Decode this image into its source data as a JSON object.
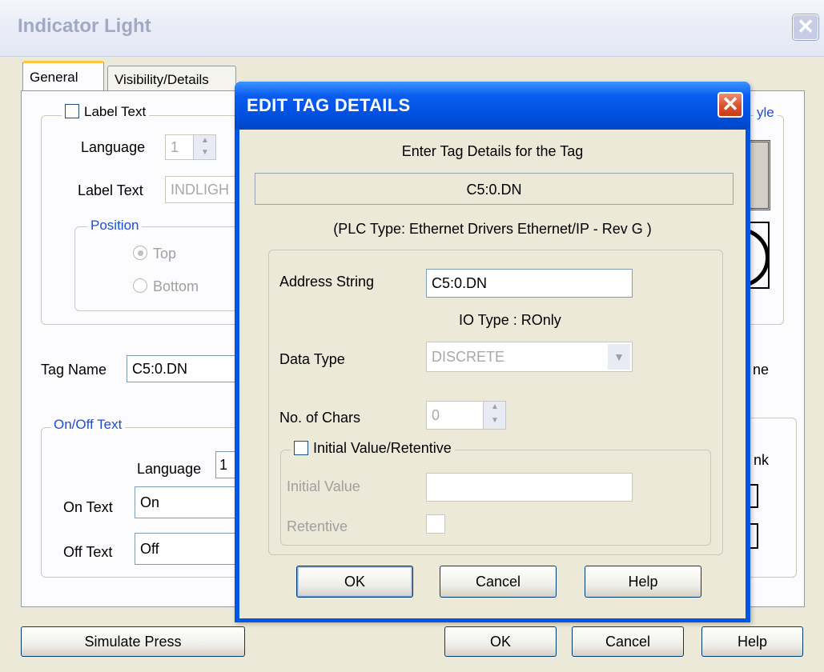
{
  "window": {
    "title": "Indicator Light",
    "close_glyph": "✕"
  },
  "tabs": [
    {
      "label": "General"
    },
    {
      "label": "Visibility/Details"
    }
  ],
  "label_group": {
    "checkbox_label": "Label Text",
    "language_label": "Language",
    "language_value": "1",
    "label_text_label": "Label Text",
    "label_text_value": "INDLIGH",
    "position_legend": "Position",
    "top_option": "Top",
    "bottom_option": "Bottom"
  },
  "style_group": {
    "legend_fragment": "yle"
  },
  "tag_name": {
    "label": "Tag Name",
    "value": "C5:0.DN"
  },
  "right_fragments": {
    "ne": "ne",
    "nk": "nk"
  },
  "onoff": {
    "legend": "On/Off Text",
    "language_label": "Language",
    "language_value": "1",
    "on_label": "On Text",
    "on_value": "On",
    "off_label": "Off Text",
    "off_value": "Off"
  },
  "footer": {
    "simulate": "Simulate Press",
    "ok": "OK",
    "cancel": "Cancel",
    "help": "Help"
  },
  "modal": {
    "title": "EDIT TAG DETAILS",
    "close_glyph": "✕",
    "prompt": "Enter Tag Details for the Tag",
    "tag": "C5:0.DN",
    "plc_type": "(PLC Type:  Ethernet Drivers Ethernet/IP - Rev G )",
    "address_label": "Address String",
    "address_value": "C5:0.DN",
    "io_type": "IO Type : ROnly",
    "data_type_label": "Data Type",
    "data_type_value": "DISCRETE",
    "chars_label": "No. of Chars",
    "chars_value": "0",
    "initial_retentive_label": "Initial Value/Retentive",
    "initial_value_label": "Initial Value",
    "retentive_label": "Retentive",
    "ok": "OK",
    "cancel": "Cancel",
    "help": "Help"
  },
  "colors": {
    "accent_blue": "#0055e5",
    "tab_highlight": "#ffc83c",
    "close_red": "#d9512c"
  }
}
